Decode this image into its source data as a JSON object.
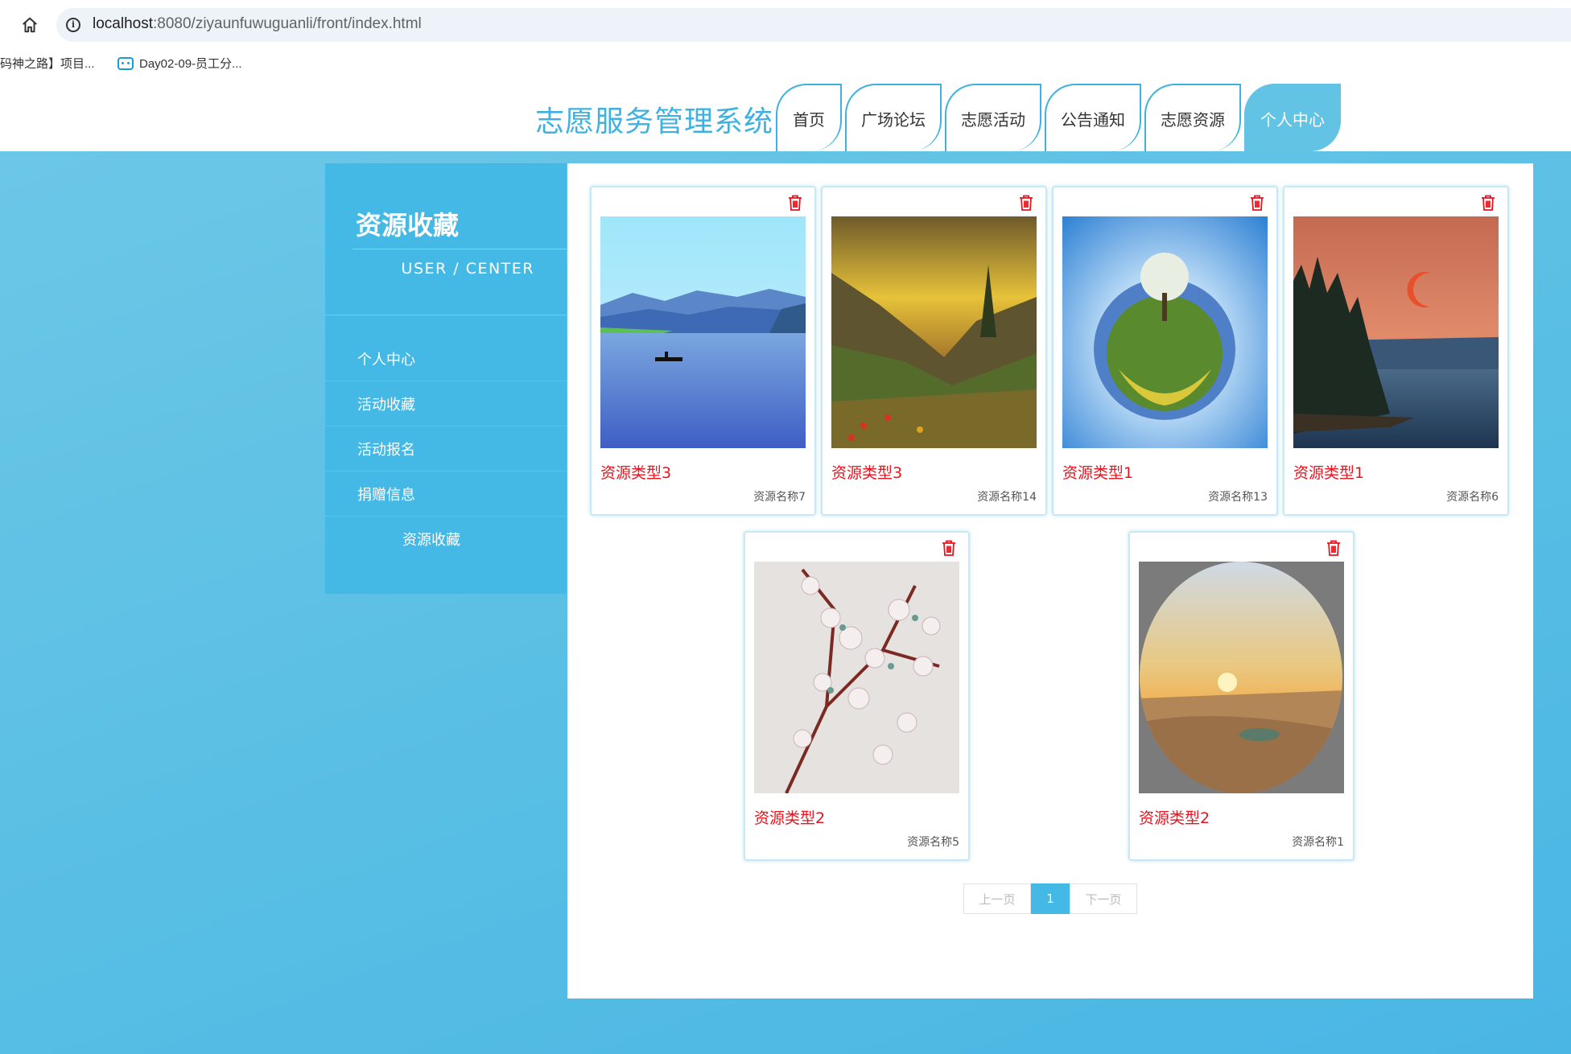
{
  "browser": {
    "url_host": "localhost",
    "url_path": ":8080/ziyaunfuwuguanli/front/index.html",
    "bookmarks": [
      "码神之路】项目...",
      "Day02-09-员工分..."
    ]
  },
  "header": {
    "site_title": "志愿服务管理系统",
    "nav": [
      "首页",
      "广场论坛",
      "志愿活动",
      "公告通知",
      "志愿资源",
      "个人中心"
    ],
    "active_nav": "个人中心"
  },
  "sidebar": {
    "title": "资源收藏",
    "subtitle": "USER / CENTER",
    "menu": [
      "个人中心",
      "活动收藏",
      "活动报名",
      "捐赠信息",
      "资源收藏"
    ],
    "active": "资源收藏"
  },
  "cards": [
    {
      "type": "资源类型3",
      "name": "资源名称7",
      "image": "lake-landscape"
    },
    {
      "type": "资源类型3",
      "name": "资源名称14",
      "image": "mountain-sunset"
    },
    {
      "type": "资源类型1",
      "name": "资源名称13",
      "image": "tiny-planet"
    },
    {
      "type": "资源类型1",
      "name": "资源名称6",
      "image": "moon-coast"
    },
    {
      "type": "资源类型2",
      "name": "资源名称5",
      "image": "blossom-branch"
    },
    {
      "type": "资源类型2",
      "name": "资源名称1",
      "image": "desert-circle"
    }
  ],
  "icons": {
    "delete": "trash-icon",
    "home": "home-icon",
    "info": "info-icon"
  },
  "pager": {
    "prev": "上一页",
    "current": "1",
    "next": "下一页"
  },
  "colors": {
    "accent": "#3eb1e0",
    "sidebar": "#44b9e5",
    "type_red": "#e8141e"
  }
}
